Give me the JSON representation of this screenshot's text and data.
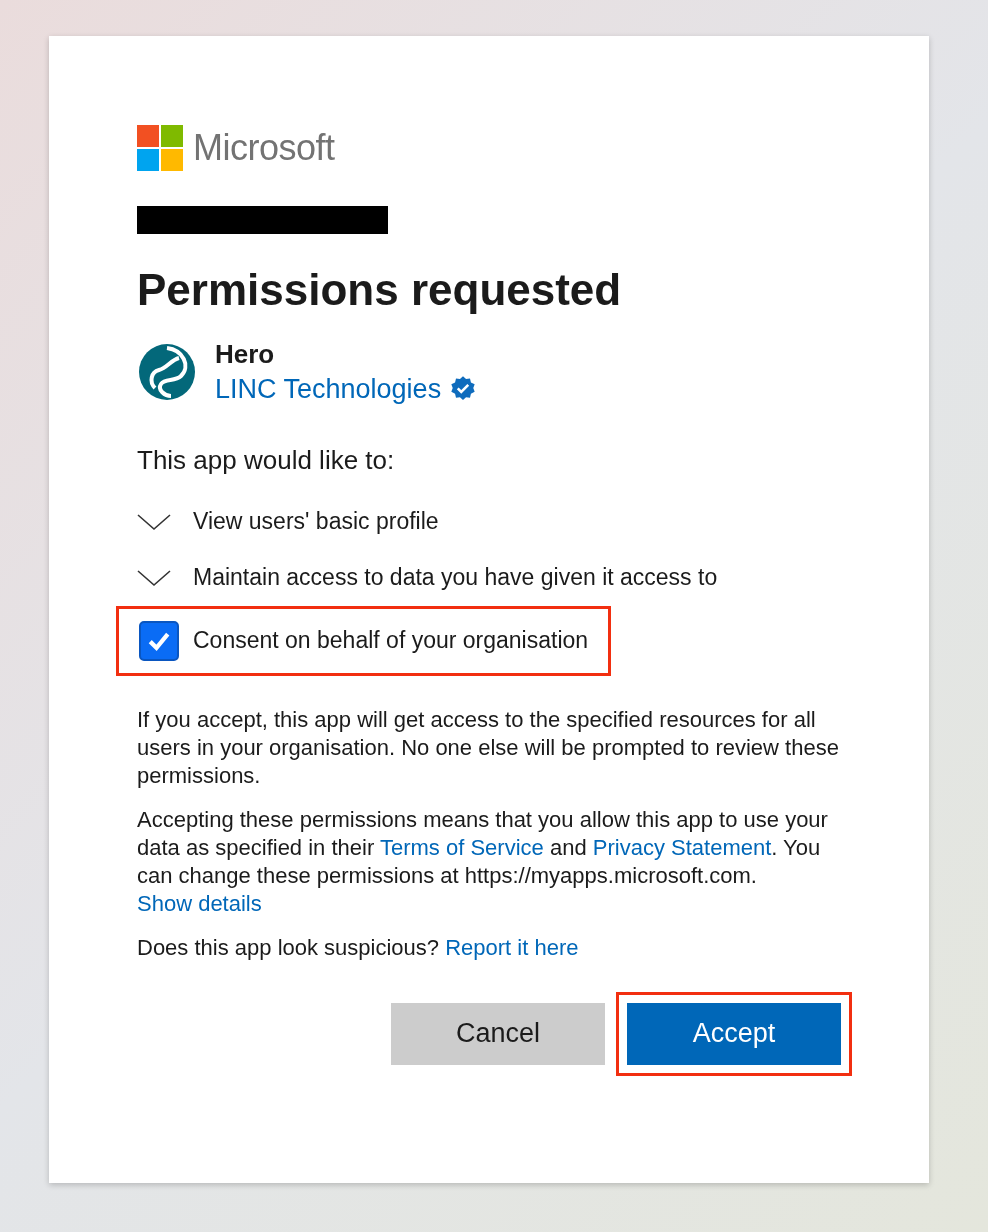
{
  "brand": {
    "name": "Microsoft"
  },
  "redacted": true,
  "title": "Permissions requested",
  "app": {
    "name": "Hero",
    "publisher": "LINC Technologies",
    "verified": true
  },
  "intro": "This app would like to:",
  "permissions": [
    {
      "label": "View users' basic profile",
      "expanded": false
    },
    {
      "label": "Maintain access to data you have given it access to",
      "expanded": false
    }
  ],
  "consent": {
    "label": "Consent on behalf of your organisation",
    "checked": true,
    "highlighted": true
  },
  "paragraphs": [
    [
      {
        "text": "If you accept, this app will get access to the specified resources for all users in your organisation. No one else will be prompted to review these permissions."
      }
    ],
    [
      {
        "text": "Accepting these permissions means that you allow this app to use your data as specified in their"
      },
      {
        "link": "Terms of Service"
      },
      {
        "text": "and"
      },
      {
        "link": "Privacy Statement"
      },
      {
        "text": ". You can change these permissions at https://myapps.microsoft.com."
      },
      {
        "link": "Show details"
      }
    ],
    [
      {
        "text": "Does this app look suspicious?"
      },
      {
        "link": "Report it here"
      }
    ]
  ],
  "buttons": [
    {
      "label": "Cancel",
      "kind": "secondary",
      "highlighted": false
    },
    {
      "label": "Accept",
      "kind": "primary",
      "highlighted": true
    }
  ]
}
